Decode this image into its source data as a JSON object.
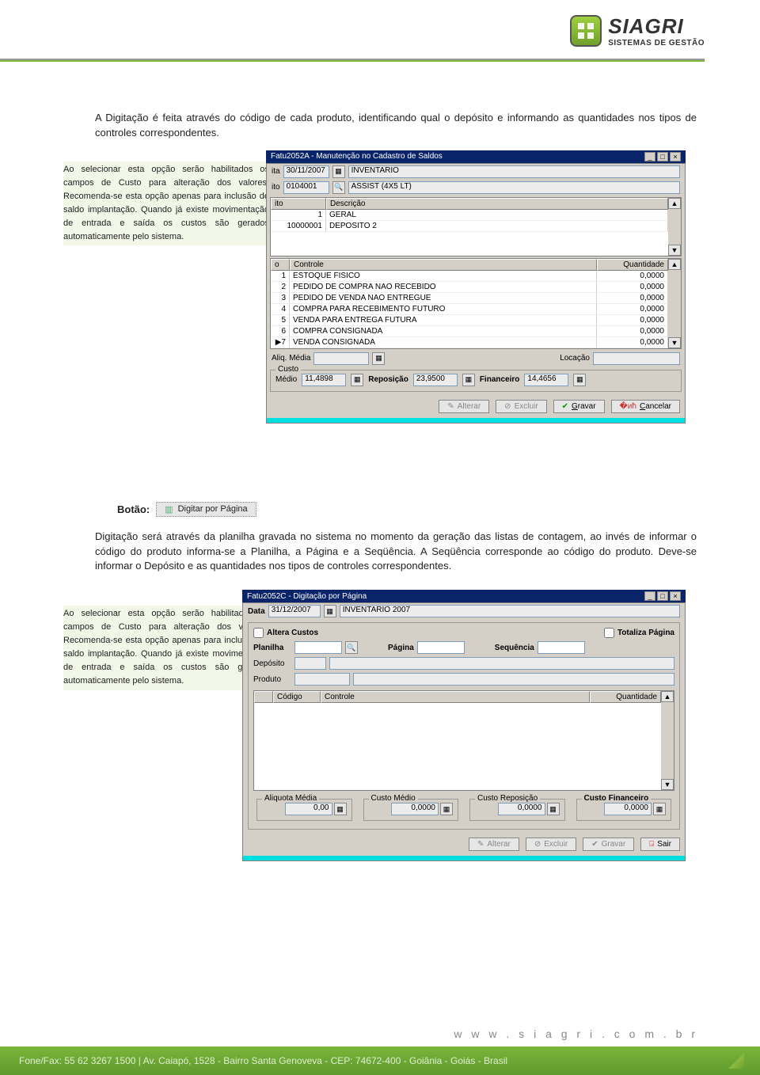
{
  "logo": {
    "main": "SIAGRI",
    "sub": "SISTEMAS DE GESTÃO"
  },
  "para1": "A Digitação é feita através do código de cada produto, identificando qual o depósito e informando as quantidades nos tipos de controles correspondentes.",
  "note1": "Ao selecionar esta opção serão habilitados os campos de Custo para alteração dos valores. Recomenda-se esta opção apenas para inclusão de saldo implantação. Quando já existe movimentação de entrada e saída os custos são gerados automaticamente pelo sistema.",
  "botao_label": "Botão:",
  "btn_digitar": "Digitar por Página",
  "para2": "Digitação será através da planilha gravada no sistema no momento da geração das listas de contagem, ao invés de informar o código do produto informa-se a Planilha, a Página e a Seqüência. A Seqüência corresponde ao código do produto. Deve-se informar o Depósito e as quantidades nos tipos de controles correspondentes.",
  "note2": "Ao selecionar esta opção serão habilitados os campos de Custo para alteração dos valores. Recomenda-se esta opção apenas para inclusão de saldo implantação. Quando já existe movimentação de entrada e saída os custos são gerados automaticamente pelo sistema.",
  "win1": {
    "title": "Fatu2052A - Manutenção no Cadastro de Saldos",
    "data_lbl": "ita",
    "data_val": "30/11/2007",
    "inv": "INVENTARIO",
    "ito_lbl": "ito",
    "ito_val": "0104001",
    "assist": "ASSIST (4X5 LT)",
    "grid1": {
      "cols": [
        "ito",
        "Descrição"
      ],
      "rows": [
        [
          "1",
          "GERAL"
        ],
        [
          "10000001",
          "DEPOSITO 2"
        ]
      ]
    },
    "grid2": {
      "cols": [
        "o",
        "Controle",
        "Quantidade"
      ],
      "rows": [
        [
          "1",
          "ESTOQUE FISICO",
          "0,0000"
        ],
        [
          "2",
          "PEDIDO DE COMPRA NAO RECEBIDO",
          "0,0000"
        ],
        [
          "3",
          "PEDIDO DE VENDA NAO ENTREGUE",
          "0,0000"
        ],
        [
          "4",
          "COMPRA PARA RECEBIMENTO FUTURO",
          "0,0000"
        ],
        [
          "5",
          "VENDA PARA ENTREGA FUTURA",
          "0,0000"
        ],
        [
          "6",
          "COMPRA CONSIGNADA",
          "0,0000"
        ],
        [
          "7",
          "VENDA CONSIGNADA",
          "0,0000"
        ]
      ]
    },
    "aliq_lbl": "Aliq. Média",
    "loc_lbl": "Locação",
    "custo_cap": "Custo",
    "medio_lbl": "Médio",
    "medio_val": "11,4898",
    "repo_lbl": "Reposição",
    "repo_val": "23,9500",
    "fin_lbl": "Financeiro",
    "fin_val": "14,4656",
    "btns": {
      "alterar": "Alterar",
      "excluir": "Excluir",
      "gravar": "Gravar",
      "cancelar": "Cancelar"
    },
    "underscores": {
      "g": "G",
      "c": "C"
    }
  },
  "win2": {
    "title": "Fatu2052C - Digitação por Página",
    "outer_lbl": "Data",
    "outer_val": "31/12/2007",
    "outer_inv": "INVENTARIO 2007",
    "chk1": "Altera Custos",
    "chk2": "Totaliza Página",
    "plan_lbl": "Planilha",
    "pag_lbl": "Página",
    "seq_lbl": "Sequência",
    "dep_lbl": "Depósito",
    "prod_lbl": "Produto",
    "grid_cols": [
      "Código",
      "Controle",
      "Quantidade"
    ],
    "grp": {
      "aliq": "Aliquota Média",
      "cm": "Custo Médio",
      "cr": "Custo Reposição",
      "cf": "Custo Financeiro",
      "aliq_v": "0,00",
      "cm_v": "0,0000",
      "cr_v": "0,0000",
      "cf_v": "0,0000"
    },
    "btns": {
      "alterar": "Alterar",
      "excluir": "Excluir",
      "gravar": "Gravar",
      "sair": "Sair"
    }
  },
  "footer": {
    "url": "w w w . s i a g r i . c o m . b r",
    "line": "Fone/Fax: 55 62 3267 1500 | Av. Caiapó, 1528 - Bairro Santa Genoveva - CEP: 74672-400 - Goiânia - Goiás - Brasil"
  }
}
